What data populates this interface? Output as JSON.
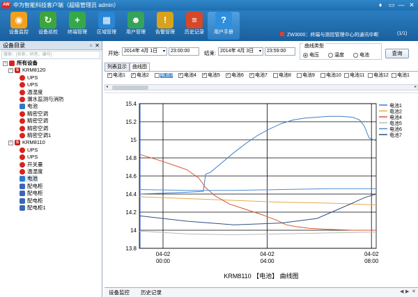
{
  "window": {
    "logo_text": "AW",
    "title": "中为智能科技客户端（超级管理员 admin）",
    "controls": [
      "♦",
      "▭",
      "—",
      "✕"
    ]
  },
  "toolbar": {
    "buttons": [
      {
        "label": "设备监控",
        "icon": "monitor-icon",
        "color": "#f0a020"
      },
      {
        "label": "设备巡检",
        "icon": "refresh-icon",
        "color": "#3ea53e"
      },
      {
        "label": "终端管理",
        "icon": "add-device-icon",
        "color": "#37a84a"
      },
      {
        "label": "区域管理",
        "icon": "building-icon",
        "color": "#2a86d6"
      },
      {
        "label": "用户管理",
        "icon": "users-icon",
        "color": "#35a35a"
      },
      {
        "label": "告警管理",
        "icon": "alarm-icon",
        "color": "#d7a21c"
      },
      {
        "label": "历史记录",
        "icon": "history-icon",
        "color": "#d74828"
      },
      {
        "label": "用户手册",
        "icon": "help-icon",
        "color": "#2e8fdc"
      }
    ],
    "active_index": 7,
    "notice": "ZW3000：终端与测控管理中心的通讯中断",
    "pager": "(1/1)"
  },
  "left_panel": {
    "title": "设备目录",
    "search_placeholder": "搜索：[名称，拼音，编号]",
    "tree": [
      {
        "level": 0,
        "label": "所有设备",
        "icon": "root",
        "toggle": "−",
        "bold": true
      },
      {
        "level": 1,
        "label": "KRM8120",
        "icon": "s",
        "toggle": "−"
      },
      {
        "level": 2,
        "label": "UPS",
        "icon": "red"
      },
      {
        "level": 2,
        "label": "UPS",
        "icon": "red"
      },
      {
        "level": 2,
        "label": "温湿度",
        "icon": "red"
      },
      {
        "level": 2,
        "label": "漏水监测与消防",
        "icon": "red"
      },
      {
        "level": 2,
        "label": "电池",
        "icon": "blue"
      },
      {
        "level": 2,
        "label": "精密空调",
        "icon": "red"
      },
      {
        "level": 2,
        "label": "精密空调",
        "icon": "red"
      },
      {
        "level": 2,
        "label": "精密空调",
        "icon": "red"
      },
      {
        "level": 2,
        "label": "精密空调1",
        "icon": "red"
      },
      {
        "level": 1,
        "label": "KRM8110",
        "icon": "s",
        "toggle": "−"
      },
      {
        "level": 2,
        "label": "UPS",
        "icon": "red"
      },
      {
        "level": 2,
        "label": "UPS",
        "icon": "red"
      },
      {
        "level": 2,
        "label": "开关量",
        "icon": "red"
      },
      {
        "level": 2,
        "label": "温湿度",
        "icon": "red"
      },
      {
        "level": 2,
        "label": "电池",
        "icon": "battery",
        "selected": true
      },
      {
        "level": 2,
        "label": "配电柜",
        "icon": "cab"
      },
      {
        "level": 2,
        "label": "配电柜",
        "icon": "cab"
      },
      {
        "level": 2,
        "label": "配电柜",
        "icon": "cab"
      },
      {
        "level": 2,
        "label": "配电柜1",
        "icon": "cab"
      }
    ]
  },
  "filter": {
    "start_label": "开始:",
    "start_date": "2014年 4月 1日",
    "start_time": "23:00:00",
    "end_label": "结束:",
    "end_date": "2014年 4月 3日",
    "end_time": "23:59:00",
    "type_label": "曲线类型",
    "radios": [
      {
        "label": "电压",
        "checked": true
      },
      {
        "label": "温度",
        "checked": false
      },
      {
        "label": "电池",
        "checked": false
      }
    ],
    "query_label": "查询"
  },
  "tabs": [
    {
      "label": "列表显示",
      "active": false
    },
    {
      "label": "曲线图",
      "active": true
    }
  ],
  "checkboxes": [
    {
      "label": "电池1",
      "checked": true
    },
    {
      "label": "电池2",
      "checked": true
    },
    {
      "label": "电池3",
      "checked": false,
      "highlight": true
    },
    {
      "label": "电池4",
      "checked": true
    },
    {
      "label": "电池5",
      "checked": true
    },
    {
      "label": "电池6",
      "checked": true
    },
    {
      "label": "电池7",
      "checked": true
    },
    {
      "label": "电池8",
      "checked": false
    },
    {
      "label": "电池9",
      "checked": false
    },
    {
      "label": "电池10",
      "checked": false
    },
    {
      "label": "电池11",
      "checked": false
    },
    {
      "label": "电池12",
      "checked": false
    },
    {
      "label": "电池1",
      "checked": false
    }
  ],
  "chart_data": {
    "type": "line",
    "title": "KRM8110 【电池】 曲线图",
    "ylim": [
      13.8,
      15.4
    ],
    "yticks": [
      "15.4",
      "15.2",
      "15",
      "14.8",
      "14.6",
      "14.4",
      "14.2",
      "14",
      "13.8"
    ],
    "xlim": [
      0,
      100
    ],
    "xticks": [
      {
        "x": 10,
        "line1": "04-02",
        "line2": "00:00"
      },
      {
        "x": 54,
        "line1": "04-02",
        "line2": "04:00"
      },
      {
        "x": 98,
        "line1": "04-02",
        "line2": "08:00"
      }
    ],
    "grid": true,
    "legend_position": "top-right",
    "series": [
      {
        "name": "电池1",
        "color": "#3f7fc3",
        "points": [
          [
            0,
            14.4
          ],
          [
            10,
            14.41
          ],
          [
            20,
            14.42
          ],
          [
            27,
            14.43
          ],
          [
            28,
            14.62
          ],
          [
            30,
            14.64
          ],
          [
            35,
            14.75
          ],
          [
            40,
            14.86
          ],
          [
            45,
            14.96
          ],
          [
            50,
            15.05
          ],
          [
            55,
            15.12
          ],
          [
            60,
            15.18
          ],
          [
            65,
            15.22
          ],
          [
            70,
            15.24
          ],
          [
            75,
            15.25
          ],
          [
            80,
            15.26
          ],
          [
            85,
            15.26
          ],
          [
            90,
            15.25
          ],
          [
            93,
            15.22
          ],
          [
            95,
            15.15
          ],
          [
            97,
            15.02
          ],
          [
            100,
            14.99
          ]
        ]
      },
      {
        "name": "电池2",
        "color": "#e7a84a",
        "points": [
          [
            0,
            14.37
          ],
          [
            20,
            14.35
          ],
          [
            40,
            14.33
          ],
          [
            60,
            14.31
          ],
          [
            80,
            14.3
          ],
          [
            100,
            14.28
          ]
        ]
      },
      {
        "name": "电池4",
        "color": "#d8542a",
        "points": [
          [
            0,
            14.84
          ],
          [
            10,
            14.76
          ],
          [
            20,
            14.67
          ],
          [
            25,
            14.58
          ],
          [
            28,
            14.47
          ],
          [
            32,
            14.38
          ],
          [
            38,
            14.29
          ],
          [
            45,
            14.23
          ],
          [
            52,
            14.17
          ],
          [
            58,
            14.11
          ],
          [
            62,
            14.06
          ],
          [
            66,
            14.04
          ],
          [
            72,
            14.02
          ],
          [
            80,
            14.01
          ],
          [
            90,
            14.0
          ],
          [
            100,
            14.0
          ]
        ]
      },
      {
        "name": "电池5",
        "color": "#b8b8b8",
        "points": [
          [
            0,
            13.99
          ],
          [
            20,
            13.96
          ],
          [
            40,
            13.95
          ],
          [
            60,
            13.96
          ],
          [
            80,
            13.97
          ],
          [
            100,
            13.98
          ]
        ]
      },
      {
        "name": "电池6",
        "color": "#4a8cd2",
        "points": [
          [
            0,
            14.45
          ],
          [
            20,
            14.44
          ],
          [
            40,
            14.44
          ],
          [
            60,
            14.45
          ],
          [
            80,
            14.46
          ],
          [
            100,
            14.46
          ]
        ]
      },
      {
        "name": "电池7",
        "color": "#2d4f80",
        "points": [
          [
            0,
            14.16
          ],
          [
            20,
            14.1
          ],
          [
            40,
            14.06
          ],
          [
            60,
            14.08
          ],
          [
            75,
            14.13
          ],
          [
            90,
            14.3
          ],
          [
            95,
            14.36
          ],
          [
            100,
            14.4
          ]
        ]
      }
    ]
  },
  "bottom_tabs": [
    {
      "label": "设备监控"
    },
    {
      "label": "历史记录"
    }
  ],
  "bottom_controls": [
    "◀",
    "▶",
    "✕"
  ]
}
